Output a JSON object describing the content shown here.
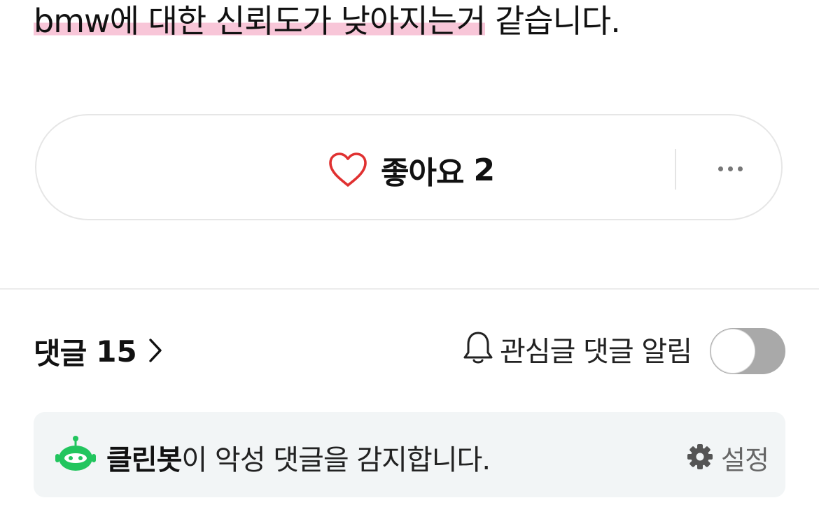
{
  "post": {
    "text_highlighted": "bmw에 대한 신뢰도가 낮아지는거",
    "text_rest": " 같습니다."
  },
  "reactions": {
    "like_label": "좋아요",
    "like_count": "2",
    "heart_icon": "heart-outline-icon",
    "more_icon": "more-horizontal-icon",
    "heart_color": "#e03131"
  },
  "comments": {
    "label": "댓글",
    "count": "15",
    "chevron_icon": "chevron-right-icon",
    "notify_icon": "bell-icon",
    "notify_label": "관심글 댓글 알림",
    "notify_enabled": false
  },
  "cleanbot": {
    "name": "클린봇",
    "message": "이 악성 댓글을 감지합니다.",
    "settings_label": "설정",
    "robot_icon": "cleanbot-robot-icon",
    "settings_icon": "gear-icon",
    "accent": "#22c55e"
  }
}
